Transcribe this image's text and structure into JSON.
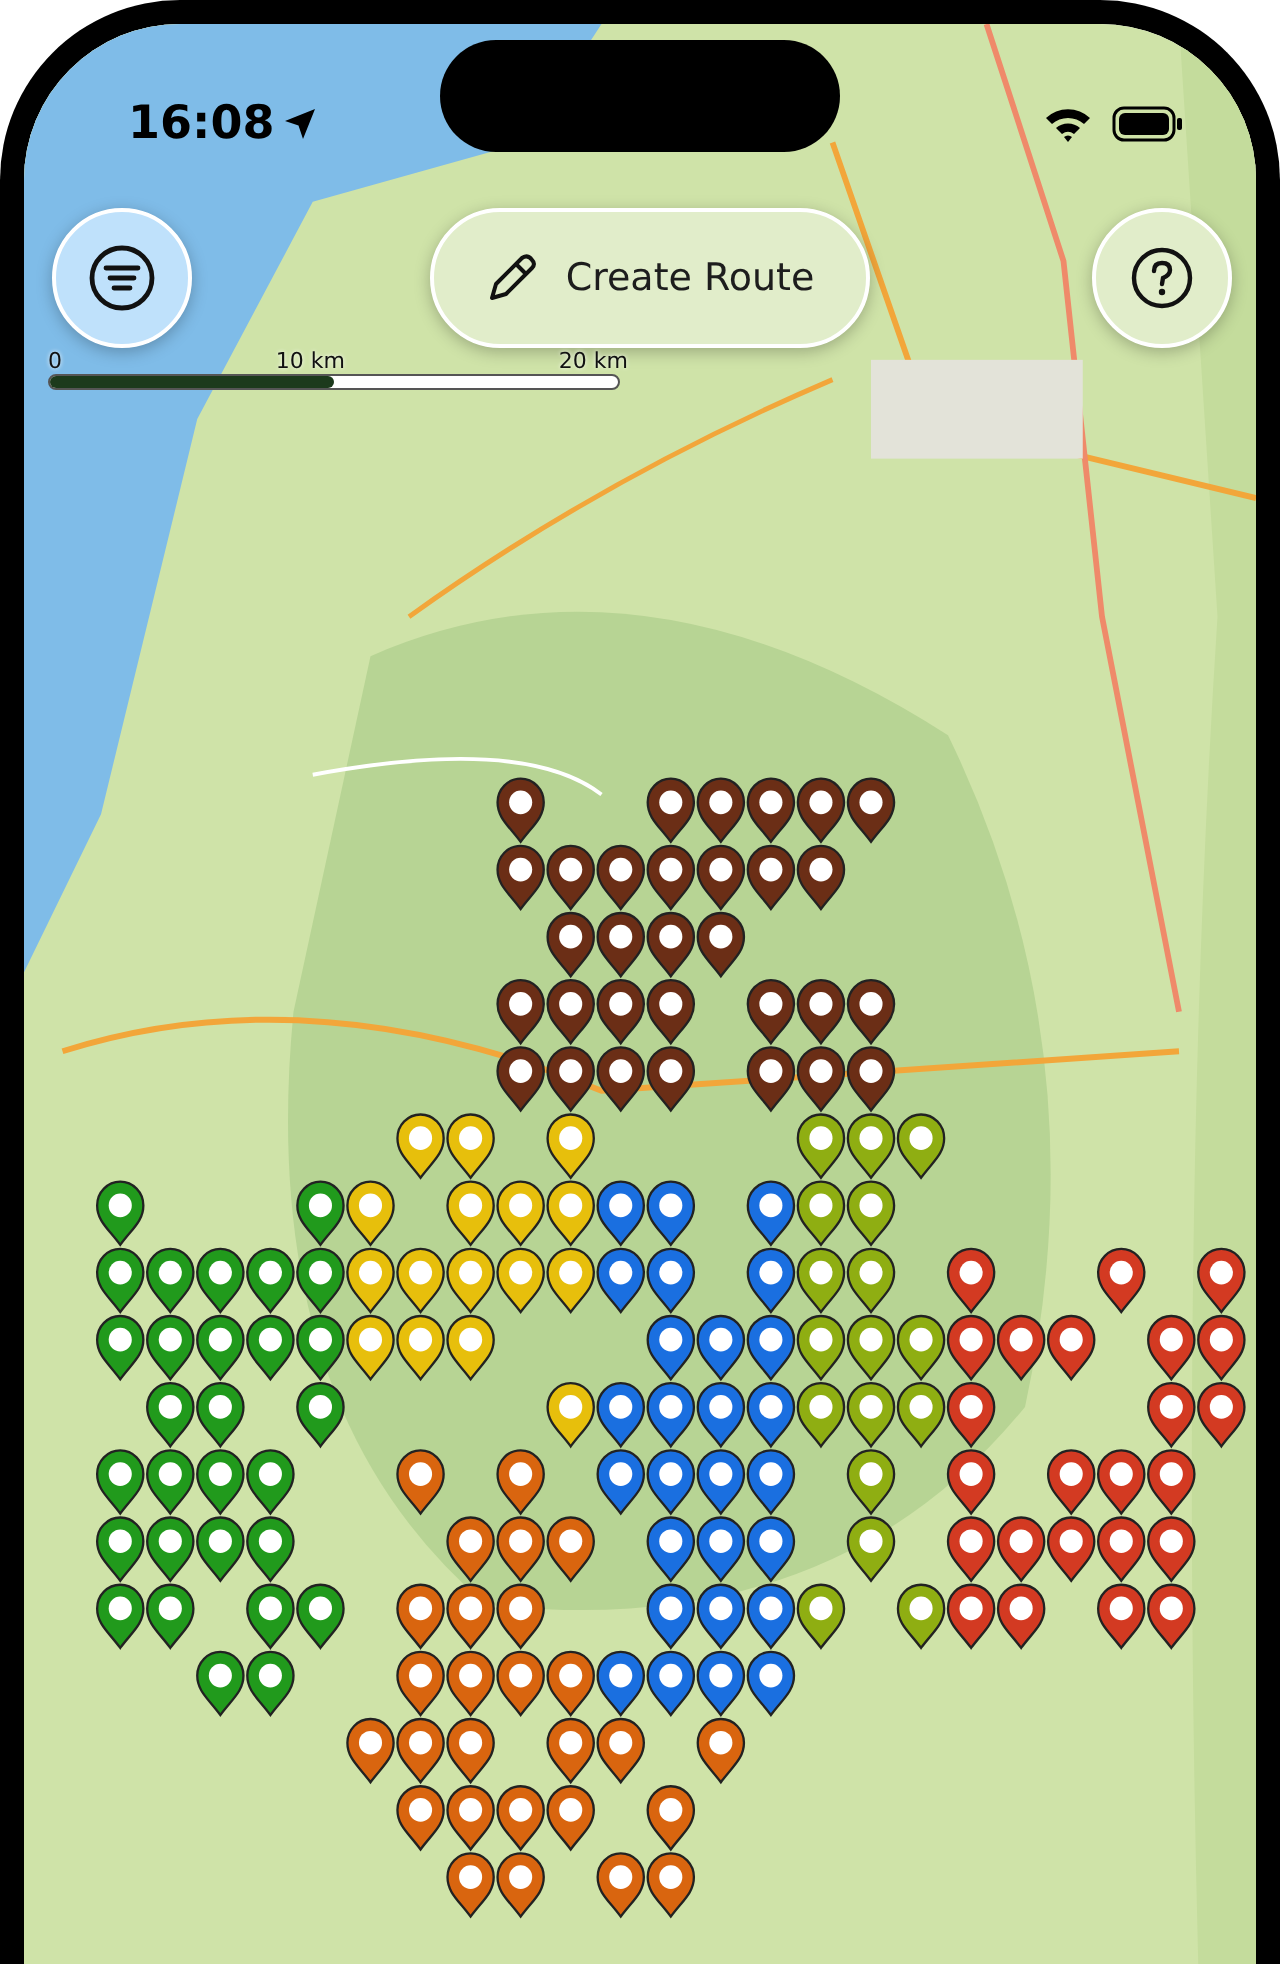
{
  "status_bar": {
    "time": "16:08"
  },
  "top_bar": {
    "create_button": {
      "label": "Create Route"
    }
  },
  "scale": {
    "labels": [
      "0",
      "10 km",
      "20 km"
    ]
  },
  "pin_groups": [
    {
      "color": "#6b2e16"
    },
    {
      "color": "#e7bf0c"
    },
    {
      "color": "#219a1c"
    },
    {
      "color": "#1a6fe0"
    },
    {
      "color": "#8fae12"
    },
    {
      "color": "#d33a22"
    },
    {
      "color": "#d9650f"
    }
  ]
}
